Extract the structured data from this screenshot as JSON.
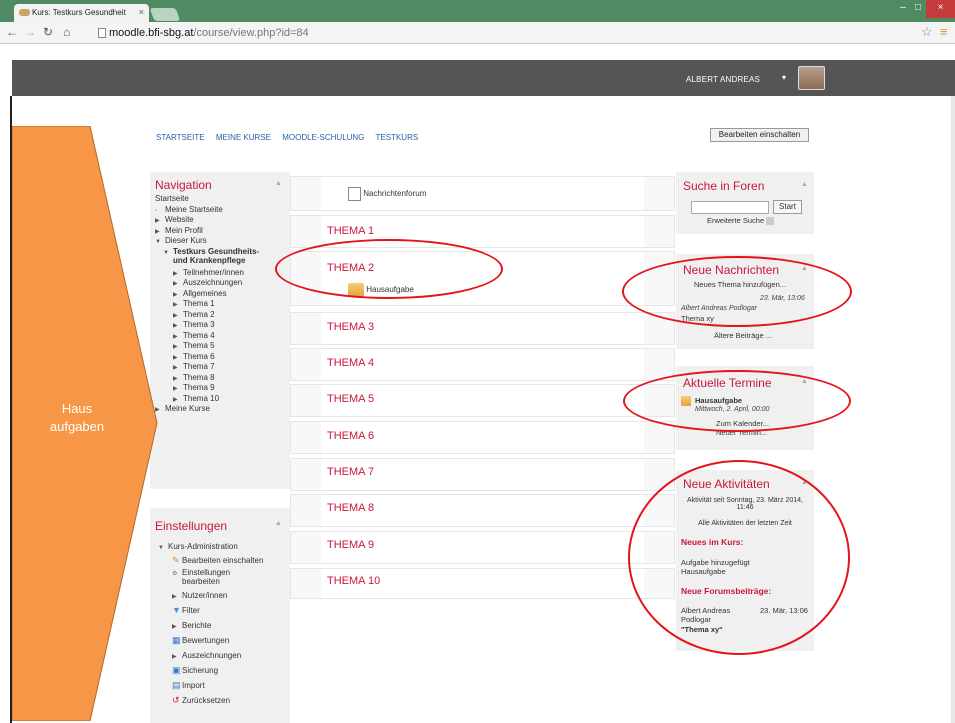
{
  "browser": {
    "tab_title": "Kurs: Testkurs Gesundheit",
    "tab_close": "×",
    "url_host": "moodle.bfi-sbg.at",
    "url_path": "/course/view.php?id=84",
    "window_buttons": [
      "–",
      "□",
      "×"
    ]
  },
  "header": {
    "user_name": "ALBERT ANDREAS",
    "caret": "▾"
  },
  "breadcrumb": [
    "STARTSEITE",
    "MEINE KURSE",
    "MOODLE-SCHULUNG",
    "TESTKURS"
  ],
  "edit_button": "Bearbeiten einschalten",
  "navigation": {
    "title": "Navigation",
    "items": [
      {
        "arrow": "",
        "label": "Startseite"
      },
      {
        "arrow": "▪",
        "label": "Meine Startseite"
      },
      {
        "arrow": "▶",
        "label": "Website"
      },
      {
        "arrow": "▶",
        "label": "Mein Profil"
      },
      {
        "arrow": "▼",
        "label": "Dieser Kurs"
      }
    ],
    "course_title_1": "Testkurs Gesundheits-",
    "course_title_2": "und Krankenpflege",
    "course_items": [
      "Teilnehmer/innen",
      "Auszeichnungen",
      "Allgemeines",
      "Thema 1",
      "Thema 2",
      "Thema 3",
      "Thema 4",
      "Thema 5",
      "Thema 6",
      "Thema 7",
      "Thema 8",
      "Thema 9",
      "Thema 10"
    ],
    "meine_kurse": "Meine Kurse"
  },
  "settings": {
    "title": "Einstellungen",
    "kurs_admin": "Kurs-Administration",
    "items": [
      "Bearbeiten einschalten",
      "Einstellungen",
      "bearbeiten",
      "Nutzer/innen",
      "Filter",
      "Berichte",
      "Bewertungen",
      "Auszeichnungen",
      "Sicherung",
      "Import",
      "Zurücksetzen"
    ]
  },
  "sections": {
    "forum": "Nachrichtenforum",
    "themes": [
      "THEMA 1",
      "THEMA 2",
      "THEMA 3",
      "THEMA 4",
      "THEMA 5",
      "THEMA 6",
      "THEMA 7",
      "THEMA 8",
      "THEMA 9",
      "THEMA 10"
    ],
    "hausaufgabe": "Hausaufgabe"
  },
  "search": {
    "title": "Suche in Foren",
    "start": "Start",
    "advanced": "Erweiterte Suche"
  },
  "news": {
    "title": "Neue Nachrichten",
    "add": "Neues Thema hinzufügen...",
    "date": "23. Mär, 13:06",
    "author": "Albert Andreas Podlogar",
    "topic": "Thema xy",
    "older": "Ältere Beiträge ..."
  },
  "events": {
    "title": "Aktuelle Termine",
    "name": "Hausaufgabe",
    "when": "Mittwoch, 2. April, 00:00",
    "calendar": "Zum Kalender...",
    "new": "Neuer Termin..."
  },
  "activities": {
    "title": "Neue Aktivitäten",
    "since_1": "Aktivität seit Sonntag, 23. März 2014,",
    "since_2": "11:46",
    "all": "Alle Aktivitäten der letzten Zeit",
    "course_news": "Neues im Kurs:",
    "added_1": "Aufgabe hinzugefügt",
    "added_2": "Hausaufgabe",
    "forum_new": "Neue Forumsbeiträge:",
    "post_author_1": "Albert Andreas",
    "post_author_2": "Podlogar",
    "post_date": "23. Mär, 13:06",
    "post_topic": "\"Thema xy\""
  },
  "annotation": {
    "line1": "Haus",
    "line2": "aufgaben",
    "arrow_color": "#f79646",
    "ellipse_color": "#e3151b"
  }
}
